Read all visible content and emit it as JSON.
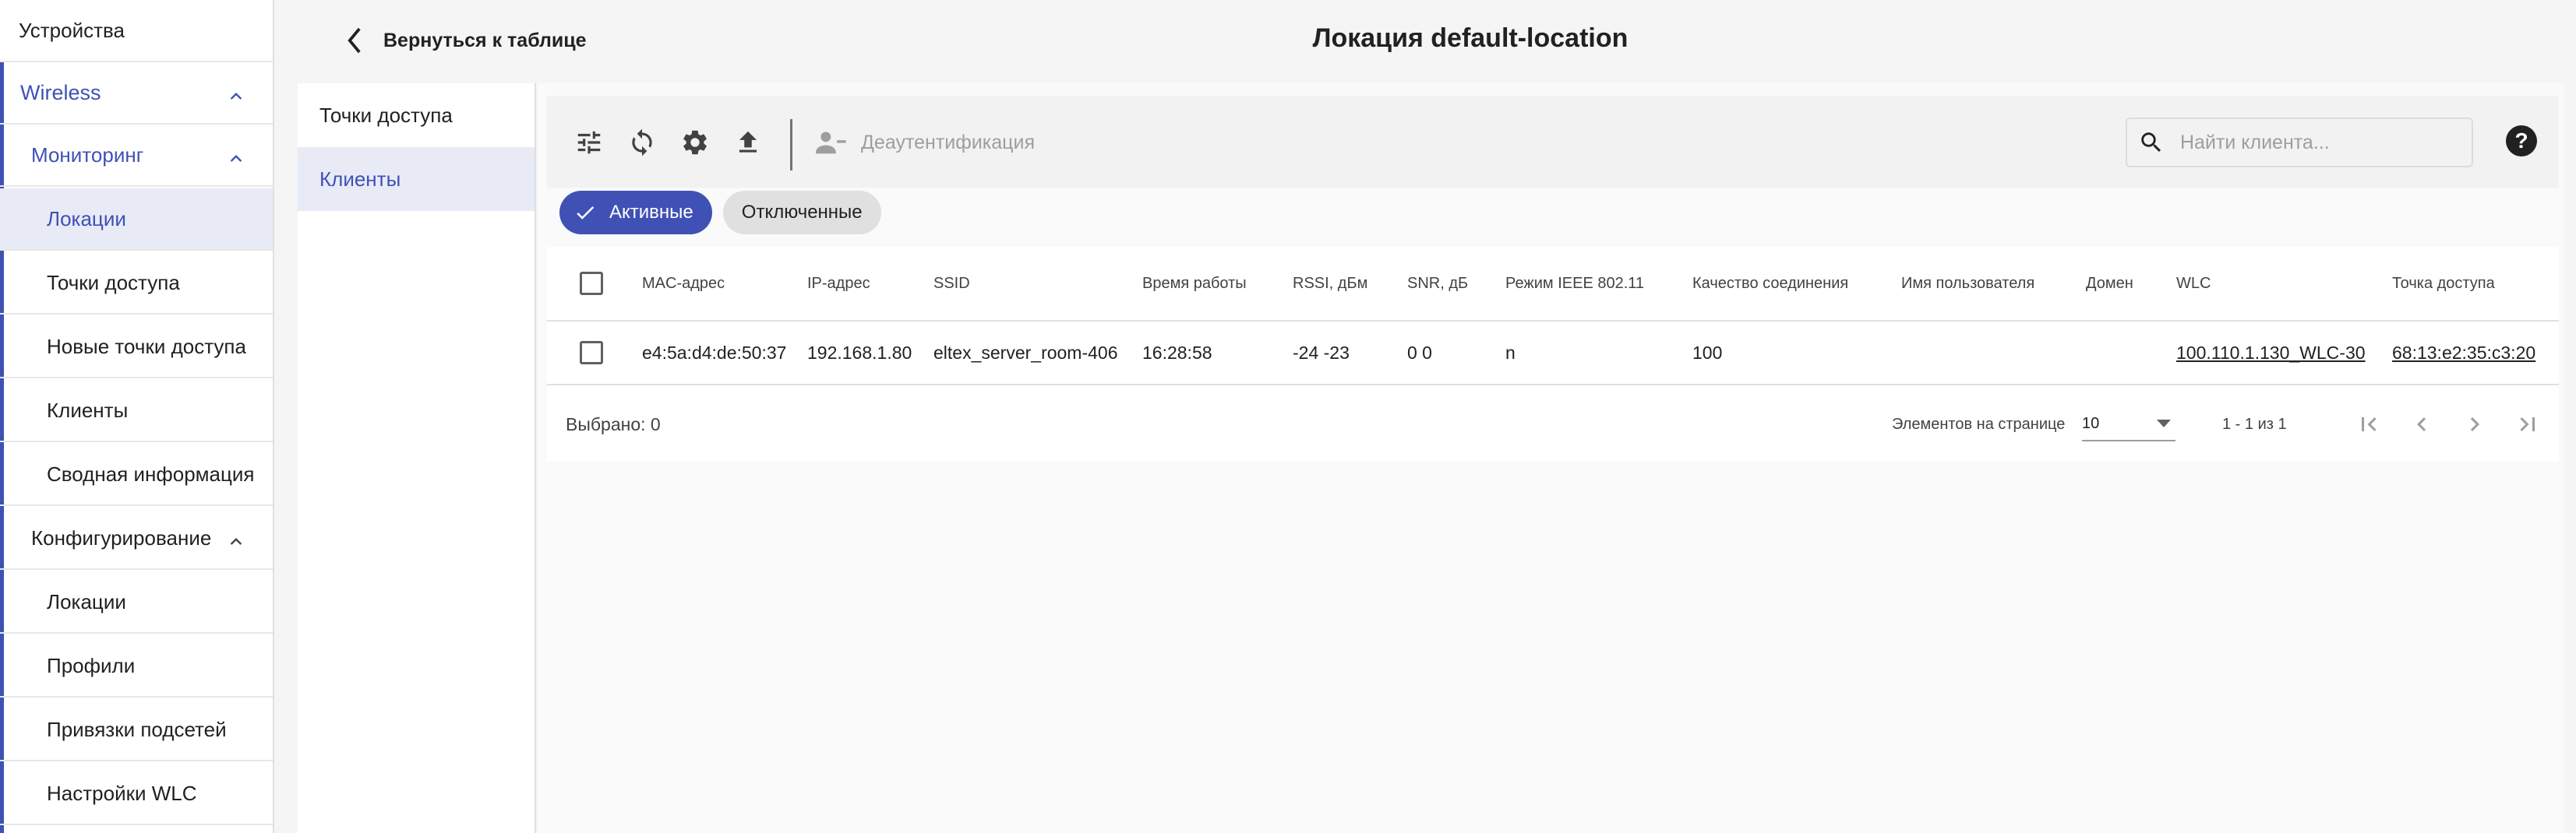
{
  "sidebar": {
    "top_item": "Устройства",
    "group": "Wireless",
    "monitoring": {
      "label": "Мониторинг",
      "items": [
        "Локации",
        "Точки доступа",
        "Новые точки доступа",
        "Клиенты",
        "Сводная информация"
      ]
    },
    "config": {
      "label": "Конфигурирование",
      "items": [
        "Локации",
        "Профили",
        "Привязки подсетей",
        "Настройки WLC"
      ]
    }
  },
  "header": {
    "back_label": "Вернуться к таблице",
    "title": "Локация default-location"
  },
  "subnav": {
    "items": [
      "Точки доступа",
      "Клиенты"
    ]
  },
  "toolbar": {
    "deauth_label": "Деаутентификация",
    "search_placeholder": "Найти клиента...",
    "help_glyph": "?"
  },
  "chips": {
    "active": "Активные",
    "disconnected": "Отключенные"
  },
  "table": {
    "columns": [
      "MAC-адрес",
      "IP-адрес",
      "SSID",
      "Время работы",
      "RSSI, дБм",
      "SNR, дБ",
      "Режим IEEE 802.11",
      "Качество соединения",
      "Имя пользователя",
      "Домен",
      "WLC",
      "Точка доступа"
    ],
    "rows": [
      {
        "mac": "e4:5a:d4:de:50:37",
        "ip": "192.168.1.80",
        "ssid": "eltex_server_room-406",
        "uptime": "16:28:58",
        "rssi": "-24 -23",
        "snr": "0 0",
        "mode": "n",
        "quality": "100",
        "user": "",
        "domain": "",
        "wlc": "100.110.1.130_WLC-30",
        "ap": "68:13:e2:35:c3:20"
      }
    ],
    "selected_label": "Выбрано: 0",
    "per_page_label": "Элементов на странице",
    "per_page_value": "10",
    "range_label": "1 - 1 из 1"
  },
  "colors": {
    "accent": "#3f51b5",
    "selected_bg": "#e8eaf6"
  }
}
